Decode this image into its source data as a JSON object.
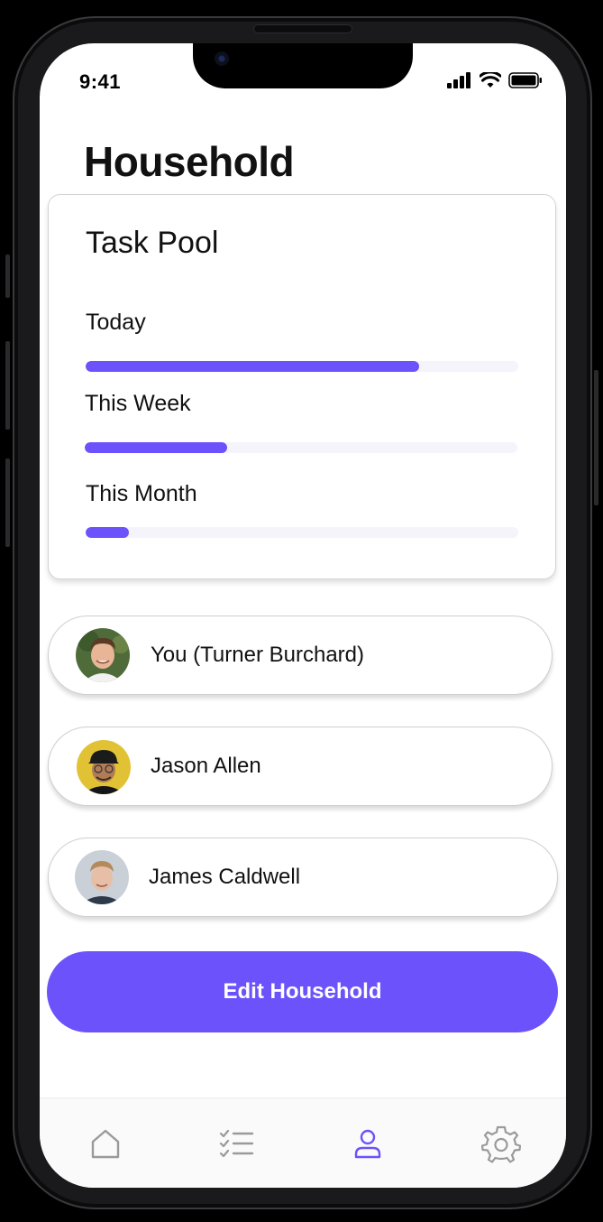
{
  "status_bar": {
    "time": "9:41"
  },
  "page": {
    "title": "Household"
  },
  "task_pool": {
    "title": "Task Pool",
    "periods": [
      {
        "label": "Today",
        "progress": 0.77
      },
      {
        "label": "This Week",
        "progress": 0.33
      },
      {
        "label": "This Month",
        "progress": 0.1
      }
    ]
  },
  "members": [
    {
      "name": "You (Turner Burchard)"
    },
    {
      "name": "Jason Allen"
    },
    {
      "name": "James Caldwell"
    }
  ],
  "actions": {
    "edit_household": "Edit Household"
  },
  "tabs": [
    {
      "icon": "home-icon",
      "active": false
    },
    {
      "icon": "checklist-icon",
      "active": false
    },
    {
      "icon": "person-icon",
      "active": true
    },
    {
      "icon": "gear-icon",
      "active": false
    }
  ],
  "colors": {
    "accent": "#6c52fb",
    "track": "#f4f4fa",
    "tab_inactive": "#9a9a9a"
  }
}
